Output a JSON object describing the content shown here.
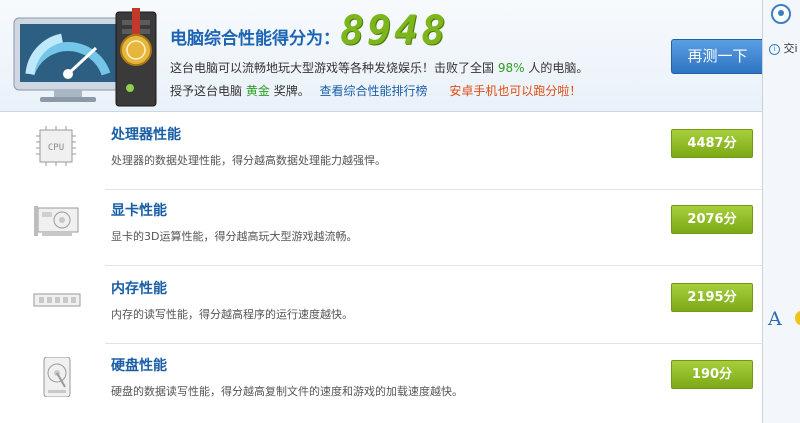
{
  "header": {
    "score_title": "电脑综合性能得分为：",
    "score_value": "8948",
    "line2_prefix": "这台电脑可以流畅地玩大型游戏等各种发烧娱乐！击败了全国",
    "line2_percent": "98%",
    "line2_suffix": "人的电脑。",
    "line3_prefix": "授予这台电脑",
    "line3_medal": "黄金",
    "line3_suffix": "奖牌。",
    "rank_link": "查看综合性能排行榜",
    "mobile_link": "安卓手机也可以跑分啦！",
    "retest_button": "再测一下"
  },
  "rows": [
    {
      "name": "处理器性能",
      "desc": "处理器的数据处理性能，得分越高数据处理能力越强悍。",
      "score": "4487分",
      "icon": "cpu-icon",
      "icon_text": "CPU"
    },
    {
      "name": "显卡性能",
      "desc": "显卡的3D运算性能，得分越高玩大型游戏越流畅。",
      "score": "2076分",
      "icon": "graphics-card-icon"
    },
    {
      "name": "内存性能",
      "desc": "内存的读写性能，得分越高程序的运行速度越快。",
      "score": "2195分",
      "icon": "memory-icon"
    },
    {
      "name": "硬盘性能",
      "desc": "硬盘的数据读写性能，得分越高复制文件的速度和游戏的加载速度越快。",
      "score": "190分",
      "icon": "hard-disk-icon"
    }
  ],
  "side": {
    "info_text": "交i",
    "font_glyph": "A"
  },
  "colors": {
    "accent_blue": "#1d64b4",
    "score_green": "#7cb51c",
    "badge_green": "#8dbb26",
    "highlight_orange": "#e04b12"
  }
}
